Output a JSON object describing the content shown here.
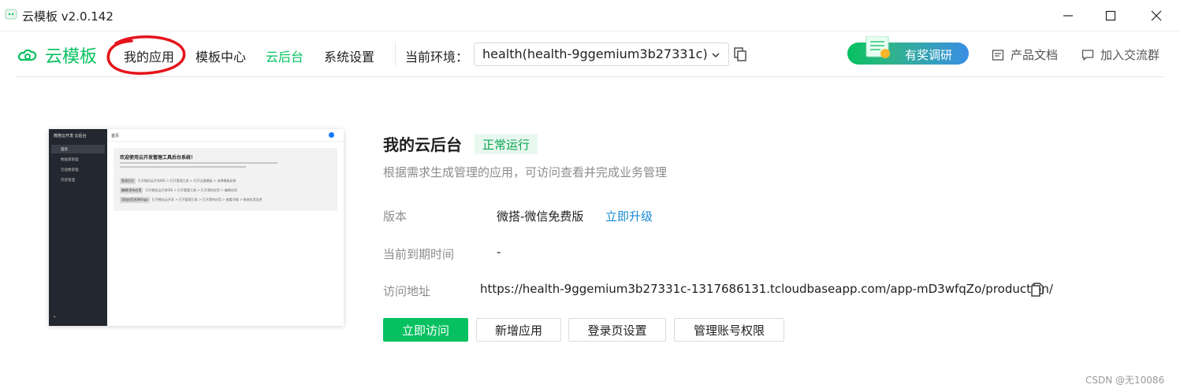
{
  "window": {
    "title": "云模板 v2.0.142"
  },
  "header": {
    "brand": "云模板",
    "nav": [
      "我的应用",
      "模板中心",
      "云后台",
      "系统设置"
    ],
    "env_label": "当前环境：",
    "env_value": "health(health-9ggemium3b27331c)",
    "survey_label": "有奖调研",
    "doc_label": "产品文档",
    "join_label": "加入交流群",
    "accent_color": "#07c160"
  },
  "preview": {
    "side_title": "微搭云开发·云后台",
    "side_items": [
      "首页",
      "数据库管理",
      "云函数管理",
      "内容管理"
    ],
    "crumb": "首页",
    "welcome": "欢迎使用云开发管理工具后台系统！",
    "steps": [
      {
        "tag": "登录后台",
        "text": "打开微信云开发IDE > 打开管理工具 > 打开全量模板 > 选择模板安装"
      },
      {
        "tag": "编辑/发布应用",
        "text": "打开微信云开发IDE > 打开管理工具 > 打开我的应用 > 编辑应用"
      },
      {
        "tag": "添加应用名称/logo",
        "text": "打开微信云开发 > 打开管理工具 > 打开我的应用 > 查看详情 > 修改应用信息"
      }
    ]
  },
  "info": {
    "title": "我的云后台",
    "status": "正常运行",
    "description": "根据需求生成管理的应用，可访问查看并完成业务管理",
    "version_label": "版本",
    "version_value": "微搭-微信免费版",
    "upgrade_label": "立即升级",
    "expire_label": "当前到期时间",
    "expire_value": "-",
    "url_label": "访问地址",
    "url_value": "https://health-9ggemium3b27331c-1317686131.tcloudbaseapp.com/app-mD3wfqZo/production/"
  },
  "actions": {
    "visit": "立即访问",
    "add_app": "新增应用",
    "login_settings": "登录页设置",
    "admin_permissions": "管理账号权限"
  },
  "watermark": "CSDN @无10086"
}
